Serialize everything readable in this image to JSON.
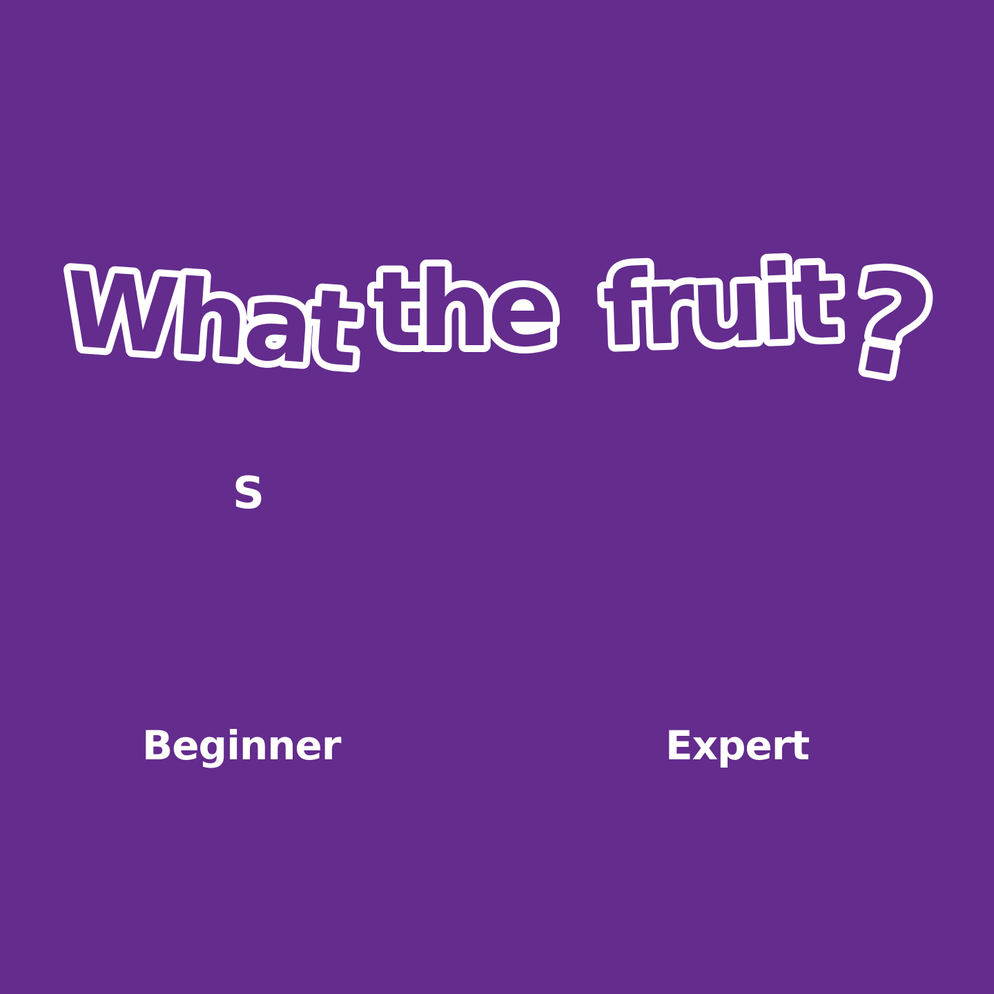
{
  "game": {
    "title_words": [
      "What",
      "the",
      "fruit"
    ],
    "title_mark": "?",
    "current_letter": "S",
    "levels": {
      "beginner": "Beginner",
      "expert": "Expert"
    }
  },
  "colors": {
    "background": "#632C8D",
    "text": "#FFFFFF",
    "title_fill": "#632C8D",
    "title_outline": "#FFFFFF"
  }
}
